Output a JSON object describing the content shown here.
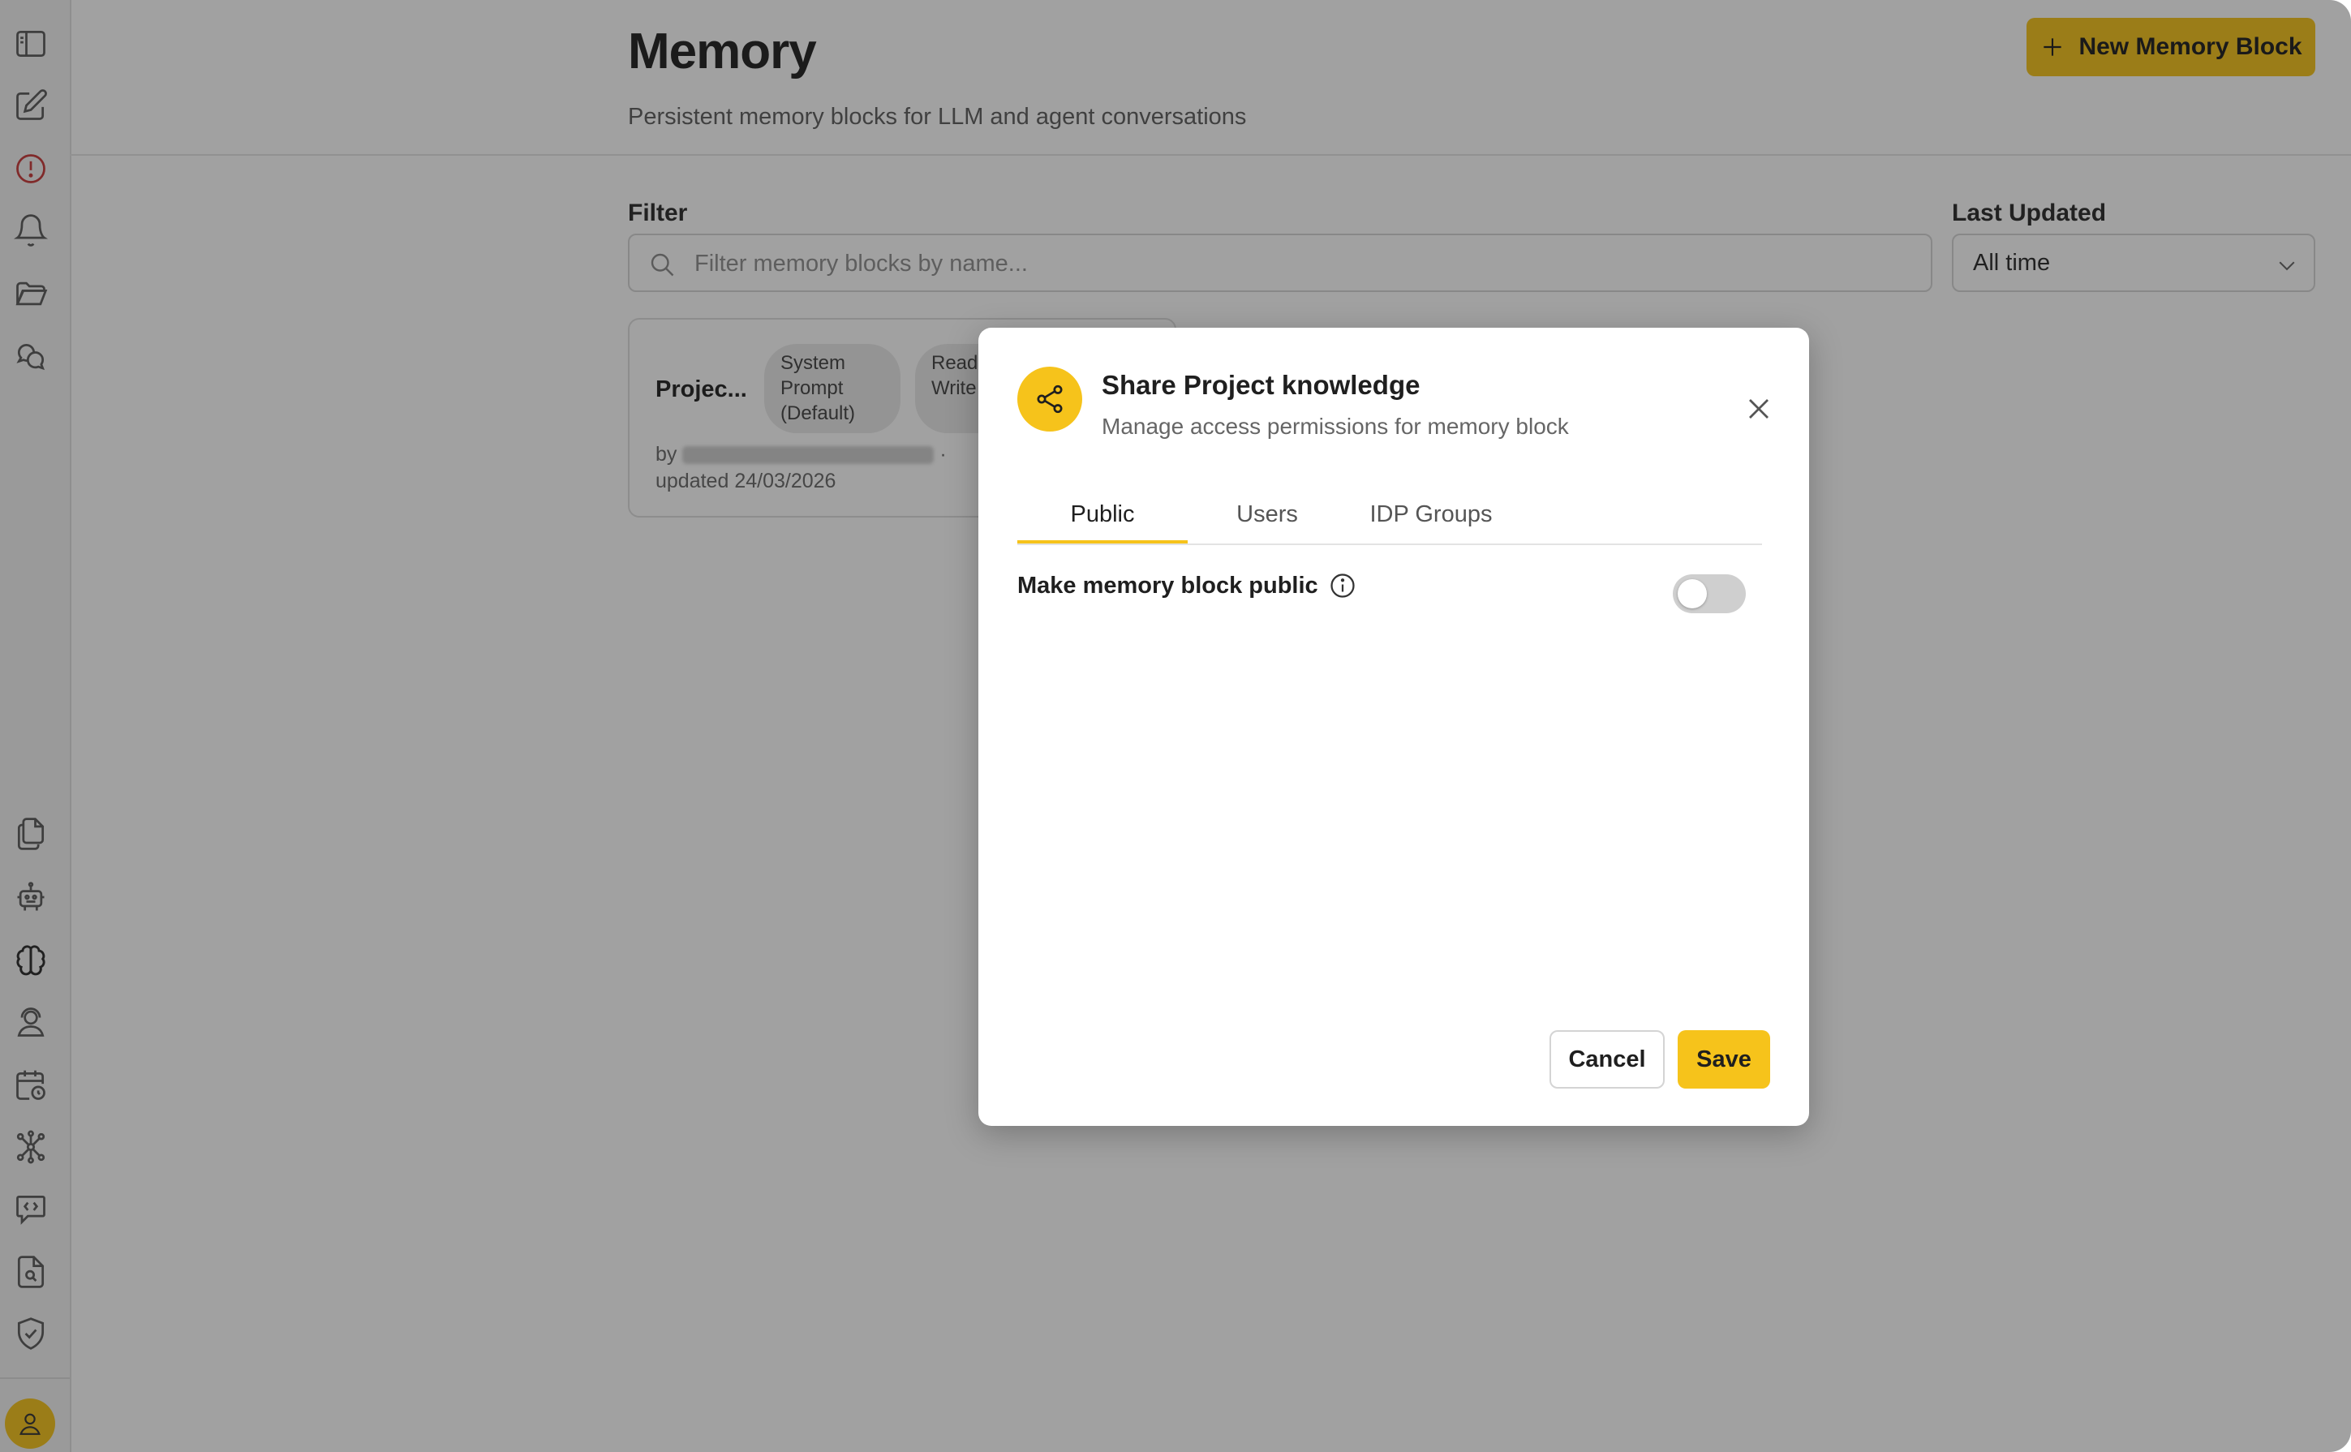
{
  "page": {
    "title": "Memory",
    "subtitle": "Persistent memory blocks for LLM and agent conversations",
    "new_button_label": "New Memory Block"
  },
  "filter": {
    "label": "Filter",
    "placeholder": "Filter memory blocks by name...",
    "value": ""
  },
  "last_updated": {
    "label": "Last Updated",
    "selected": "All time"
  },
  "card": {
    "title": "Projec...",
    "tag_1": "System Prompt (Default)",
    "tag_2": "Read & Write",
    "by_prefix": "by",
    "separator": "·",
    "updated": "updated 24/03/2026"
  },
  "modal": {
    "title": "Share Project knowledge",
    "subtitle": "Manage access permissions for memory block",
    "tabs": [
      "Public",
      "Users",
      "IDP Groups"
    ],
    "active_tab": "Public",
    "toggle_label": "Make memory block public",
    "toggle_on": false,
    "cancel_label": "Cancel",
    "save_label": "Save"
  },
  "colors": {
    "accent": "#f6c31b",
    "overlay": "rgba(20,20,20,0.40)"
  },
  "sidebar": {
    "top_icons": [
      "sidebar-toggle-icon",
      "compose-icon",
      "alert-icon",
      "bell-icon",
      "folder-icon",
      "chat-icon"
    ],
    "bottom_icons": [
      "documents-icon",
      "robot-icon",
      "brain-icon",
      "support-agent-icon",
      "calendar-clock-icon",
      "network-icon",
      "code-chat-icon",
      "file-search-icon",
      "shield-check-icon"
    ],
    "avatar": "user-icon"
  }
}
